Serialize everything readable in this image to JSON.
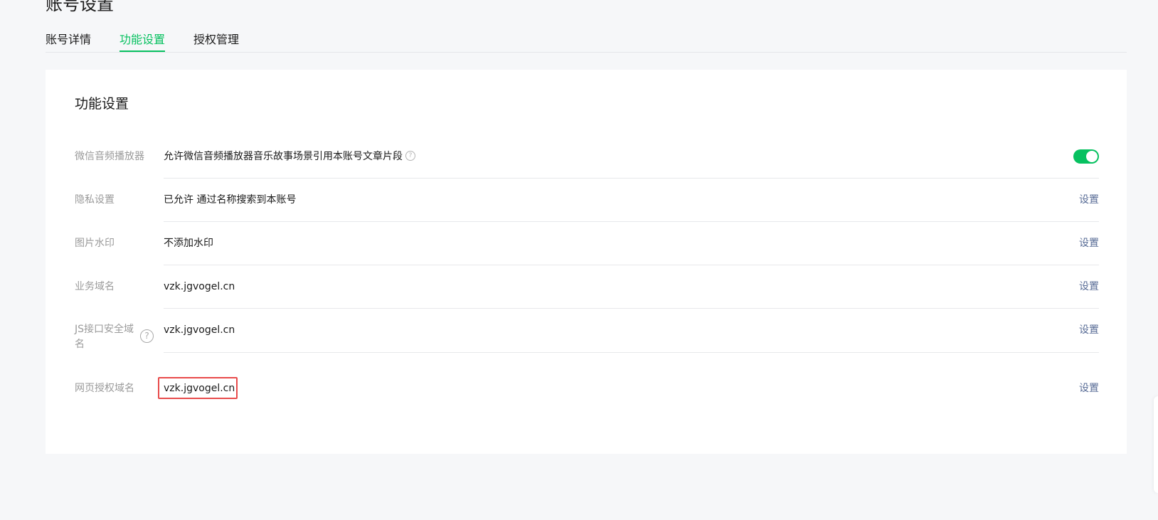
{
  "page": {
    "title": "账号设置"
  },
  "tabs": [
    {
      "label": "账号详情",
      "active": false
    },
    {
      "label": "功能设置",
      "active": true
    },
    {
      "label": "授权管理",
      "active": false
    }
  ],
  "panel": {
    "title": "功能设置",
    "rows": [
      {
        "label": "微信音频播放器",
        "value": "允许微信音频播放器音乐故事场景引用本账号文章片段",
        "control": "toggle",
        "toggle_on": true
      },
      {
        "label": "隐私设置",
        "value": "已允许 通过名称搜索到本账号",
        "action": "设置"
      },
      {
        "label": "图片水印",
        "value": "不添加水印",
        "action": "设置"
      },
      {
        "label": "业务域名",
        "value": "vzk.jgvogel.cn",
        "action": "设置"
      },
      {
        "label": "JS接口安全域名",
        "value": "vzk.jgvogel.cn",
        "action": "设置"
      },
      {
        "label": "网页授权域名",
        "value": "vzk.jgvogel.cn",
        "action": "设置",
        "highlighted": true
      }
    ]
  },
  "icons": {
    "help": "?"
  },
  "colors": {
    "accent": "#07c160",
    "link": "#576b95",
    "highlight": "#e84b4b"
  }
}
